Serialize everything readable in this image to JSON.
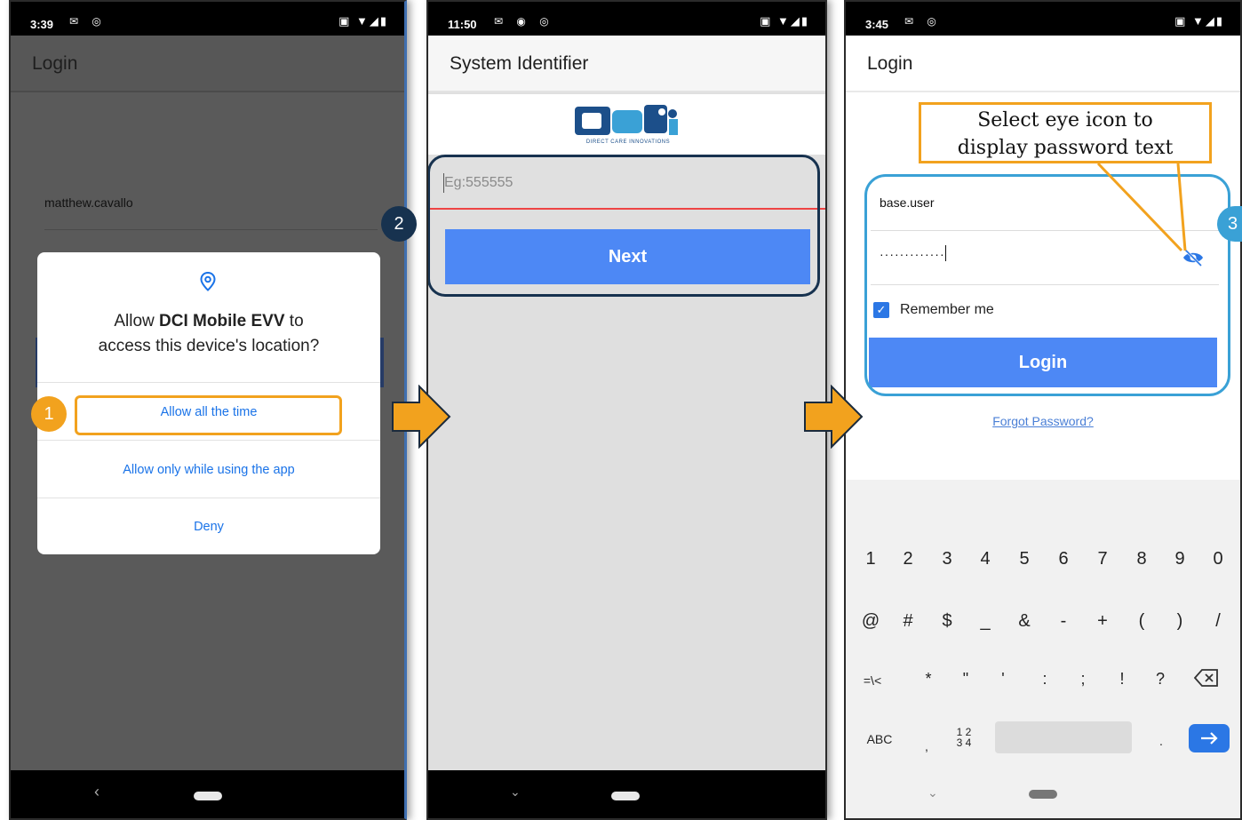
{
  "phone1": {
    "status_time": "3:39",
    "app_title": "Login",
    "username": "matthew.cavallo",
    "dialog": {
      "question_prefix": "Allow ",
      "app_name": "DCI Mobile EVV",
      "question_suffix_1": " to",
      "question_line2": "access this device's location?",
      "options": [
        "Allow all the time",
        "Allow only while using the app",
        "Deny"
      ]
    },
    "step_badge": "1"
  },
  "phone2": {
    "status_time": "11:50",
    "app_title": "System Identifier",
    "logo_text": "DIRECT CARE INNOVATIONS",
    "input_placeholder": "Eg:555555",
    "next_label": "Next",
    "step_badge": "2"
  },
  "phone3": {
    "status_time": "3:45",
    "app_title": "Login",
    "username": "base.user",
    "password_mask": "·············",
    "remember_label": "Remember me",
    "login_label": "Login",
    "forgot_label": "Forgot Password?",
    "callout_line1": "Select eye icon to",
    "callout_line2": "display password text",
    "step_badge": "3",
    "keyboard": {
      "row1": [
        "1",
        "2",
        "3",
        "4",
        "5",
        "6",
        "7",
        "8",
        "9",
        "0"
      ],
      "row2": [
        "@",
        "#",
        "$",
        "_",
        "&",
        "-",
        "+",
        "(",
        ")",
        "/"
      ],
      "row3": [
        "=\\<",
        "*",
        "\"",
        "'",
        ":",
        ";",
        "!",
        "?"
      ],
      "abc_label": "ABC",
      "comma": ",",
      "numpad_top": "1 2",
      "numpad_bottom": "3 4",
      "period": "."
    }
  },
  "colors": {
    "accent_orange": "#f2a21e",
    "badge_blue": "#3aa1d6",
    "badge_navy": "#17324f",
    "button_blue": "#4d88f5"
  }
}
